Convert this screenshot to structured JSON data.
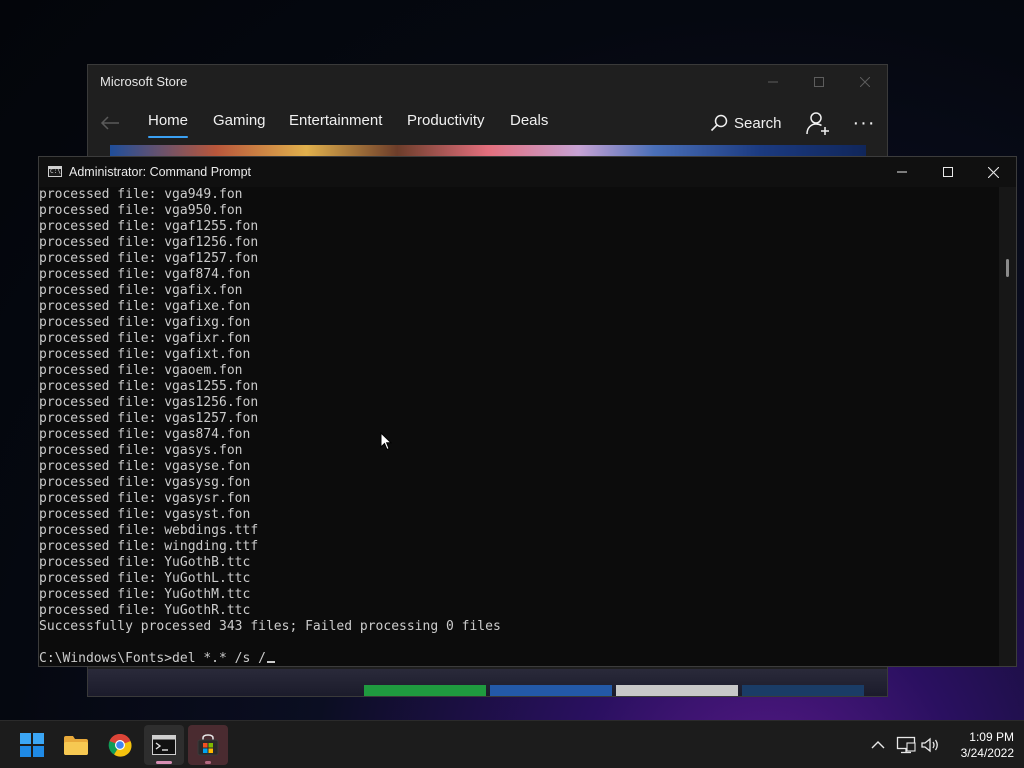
{
  "store": {
    "title": "Microsoft Store",
    "tabs": [
      "Home",
      "Gaming",
      "Entertainment",
      "Productivity",
      "Deals"
    ],
    "active_tab": "Home",
    "search_label": "Search",
    "more_label": "···"
  },
  "cmd": {
    "title": "Administrator: Command Prompt",
    "lines": [
      "processed file: vga949.fon",
      "processed file: vga950.fon",
      "processed file: vgaf1255.fon",
      "processed file: vgaf1256.fon",
      "processed file: vgaf1257.fon",
      "processed file: vgaf874.fon",
      "processed file: vgafix.fon",
      "processed file: vgafixe.fon",
      "processed file: vgafixg.fon",
      "processed file: vgafixr.fon",
      "processed file: vgafixt.fon",
      "processed file: vgaoem.fon",
      "processed file: vgas1255.fon",
      "processed file: vgas1256.fon",
      "processed file: vgas1257.fon",
      "processed file: vgas874.fon",
      "processed file: vgasys.fon",
      "processed file: vgasyse.fon",
      "processed file: vgasysg.fon",
      "processed file: vgasysr.fon",
      "processed file: vgasyst.fon",
      "processed file: webdings.ttf",
      "processed file: wingding.ttf",
      "processed file: YuGothB.ttc",
      "processed file: YuGothL.ttc",
      "processed file: YuGothM.ttc",
      "processed file: YuGothR.ttc",
      "Successfully processed 343 files; Failed processing 0 files",
      "",
      "C:\\Windows\\Fonts>del *.* /s /"
    ]
  },
  "taskbar": {
    "apps": [
      "start-icon",
      "file-explorer-icon",
      "chrome-icon",
      "terminal-icon",
      "store-icon"
    ],
    "time": "1:09 PM",
    "date": "3/24/2022"
  }
}
